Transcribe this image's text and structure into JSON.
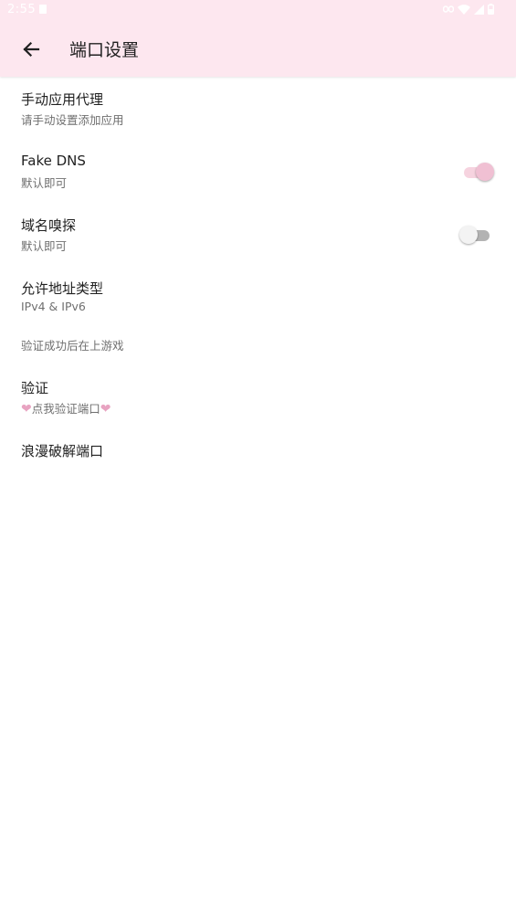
{
  "status_bar": {
    "time": "2:55"
  },
  "app_bar": {
    "title": "端口设置"
  },
  "settings": {
    "manual_proxy": {
      "title": "手动应用代理",
      "summary": "请手动设置添加应用"
    },
    "fake_dns": {
      "title": "Fake DNS",
      "summary": "默认即可",
      "enabled": true
    },
    "domain_sniffing": {
      "title": "域名嗅探",
      "summary": "默认即可",
      "enabled": false
    },
    "address_type": {
      "title": "允许地址类型",
      "summary": "IPv4 & IPv6"
    },
    "category": {
      "label": "验证成功后在上游戏"
    },
    "verify": {
      "title": "验证",
      "summary": "点我验证端口",
      "heart": "❤"
    },
    "crack_port": {
      "title": "浪漫破解端口"
    }
  },
  "colors": {
    "app_bar_bg": "#fde7ef",
    "accent": "#f0c0d3",
    "heart": "#e8a3c1"
  }
}
